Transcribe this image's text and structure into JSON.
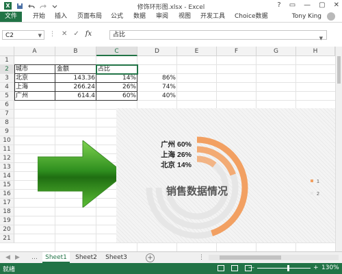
{
  "window": {
    "title": "修饰环形图.xlsx - Excel",
    "controls": [
      "?",
      "▭",
      "—",
      "▢",
      "✕"
    ]
  },
  "ribbon": {
    "tabs": [
      "文件",
      "开始",
      "插入",
      "页面布局",
      "公式",
      "数据",
      "审阅",
      "视图",
      "开发工具",
      "Choice数据"
    ],
    "user": "Tony King"
  },
  "formula_bar": {
    "name_box": "C2",
    "formula": "占比",
    "fx": "fx",
    "cancel": "✕",
    "enter": "✓"
  },
  "columns": [
    "A",
    "B",
    "C",
    "D",
    "E",
    "F",
    "G",
    "H"
  ],
  "rows": [
    "1",
    "2",
    "3",
    "4",
    "5",
    "6",
    "7",
    "8",
    "9",
    "10",
    "11",
    "12",
    "13",
    "14",
    "15",
    "16",
    "17",
    "18",
    "19",
    "20",
    "21"
  ],
  "selected": {
    "column": "C",
    "row": "2"
  },
  "cells": {
    "a2": "城市",
    "b2": "金额",
    "c2": "占比",
    "a3": "北京",
    "b3": "143.36",
    "c3": "14%",
    "d3": "86%",
    "a4": "上海",
    "b4": "266.24",
    "c4": "26%",
    "d4": "74%",
    "a5": "广州",
    "b5": "614.4",
    "c5": "60%",
    "d5": "40%"
  },
  "chart_data": {
    "type": "pie",
    "subtype": "doughnut",
    "title": "销售数据情况",
    "rings": [
      {
        "name": "广州",
        "value": 60,
        "remainder": 40,
        "label": "广州 60%"
      },
      {
        "name": "上海",
        "value": 26,
        "remainder": 74,
        "label": "上海 26%"
      },
      {
        "name": "北京",
        "value": 14,
        "remainder": 86,
        "label": "北京 14%"
      }
    ],
    "series_colors": {
      "value": "#f2a062",
      "remainder": "#d9d9d9"
    },
    "legend": {
      "position": "right",
      "entries": [
        "1",
        "2"
      ]
    }
  },
  "sheets": {
    "tabs": [
      "Sheet1",
      "Sheet2",
      "Sheet3"
    ],
    "active": "Sheet1",
    "add": "+"
  },
  "status": {
    "ready": "就绪",
    "zoom": "130%",
    "zoom_minus": "—",
    "zoom_plus": "+"
  },
  "colors": {
    "accent": "#217346",
    "arrow": "#2f8f1f"
  }
}
